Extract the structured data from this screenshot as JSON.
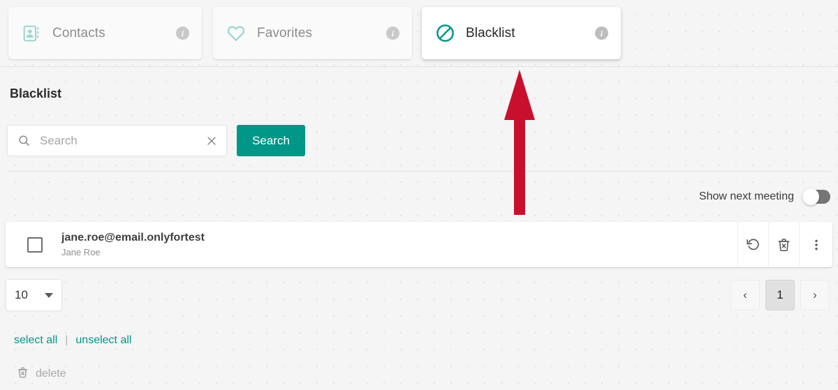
{
  "tabs": [
    {
      "id": "contacts",
      "label": "Contacts",
      "icon": "contact-card-icon",
      "active": false,
      "info": "i"
    },
    {
      "id": "favorites",
      "label": "Favorites",
      "icon": "heart-icon",
      "active": false,
      "info": "i"
    },
    {
      "id": "blacklist",
      "label": "Blacklist",
      "icon": "block-icon",
      "active": true,
      "info": "i"
    }
  ],
  "page": {
    "title": "Blacklist"
  },
  "search": {
    "value": "",
    "placeholder": "Search",
    "button_label": "Search",
    "search_icon": "search-icon",
    "clear_icon": "close-icon"
  },
  "options": {
    "show_next_meeting_label": "Show next meeting",
    "show_next_meeting_enabled": false
  },
  "list": {
    "rows": [
      {
        "email": "jane.roe@email.onlyfortest",
        "name": "Jane Roe",
        "checked": false,
        "actions": [
          "restore-icon",
          "delete-forever-icon",
          "more-vertical-icon"
        ]
      }
    ]
  },
  "pagination": {
    "page_size": "10",
    "prev_label": "‹",
    "next_label": "›",
    "pages": [
      "1"
    ],
    "current_page": "1"
  },
  "bulk": {
    "select_all_label": "select all",
    "separator": "|",
    "unselect_all_label": "unselect all",
    "delete_label": "delete",
    "delete_icon": "delete-forever-icon"
  },
  "colors": {
    "accent_teal": "#009688",
    "tab_icon_muted": "#9fd6d0",
    "annotation_red": "#C8102E",
    "background": "#f5f5f5"
  },
  "annotation": {
    "type": "arrow",
    "direction": "up",
    "points_to": "blacklist-tab",
    "color": "#C8102E"
  }
}
